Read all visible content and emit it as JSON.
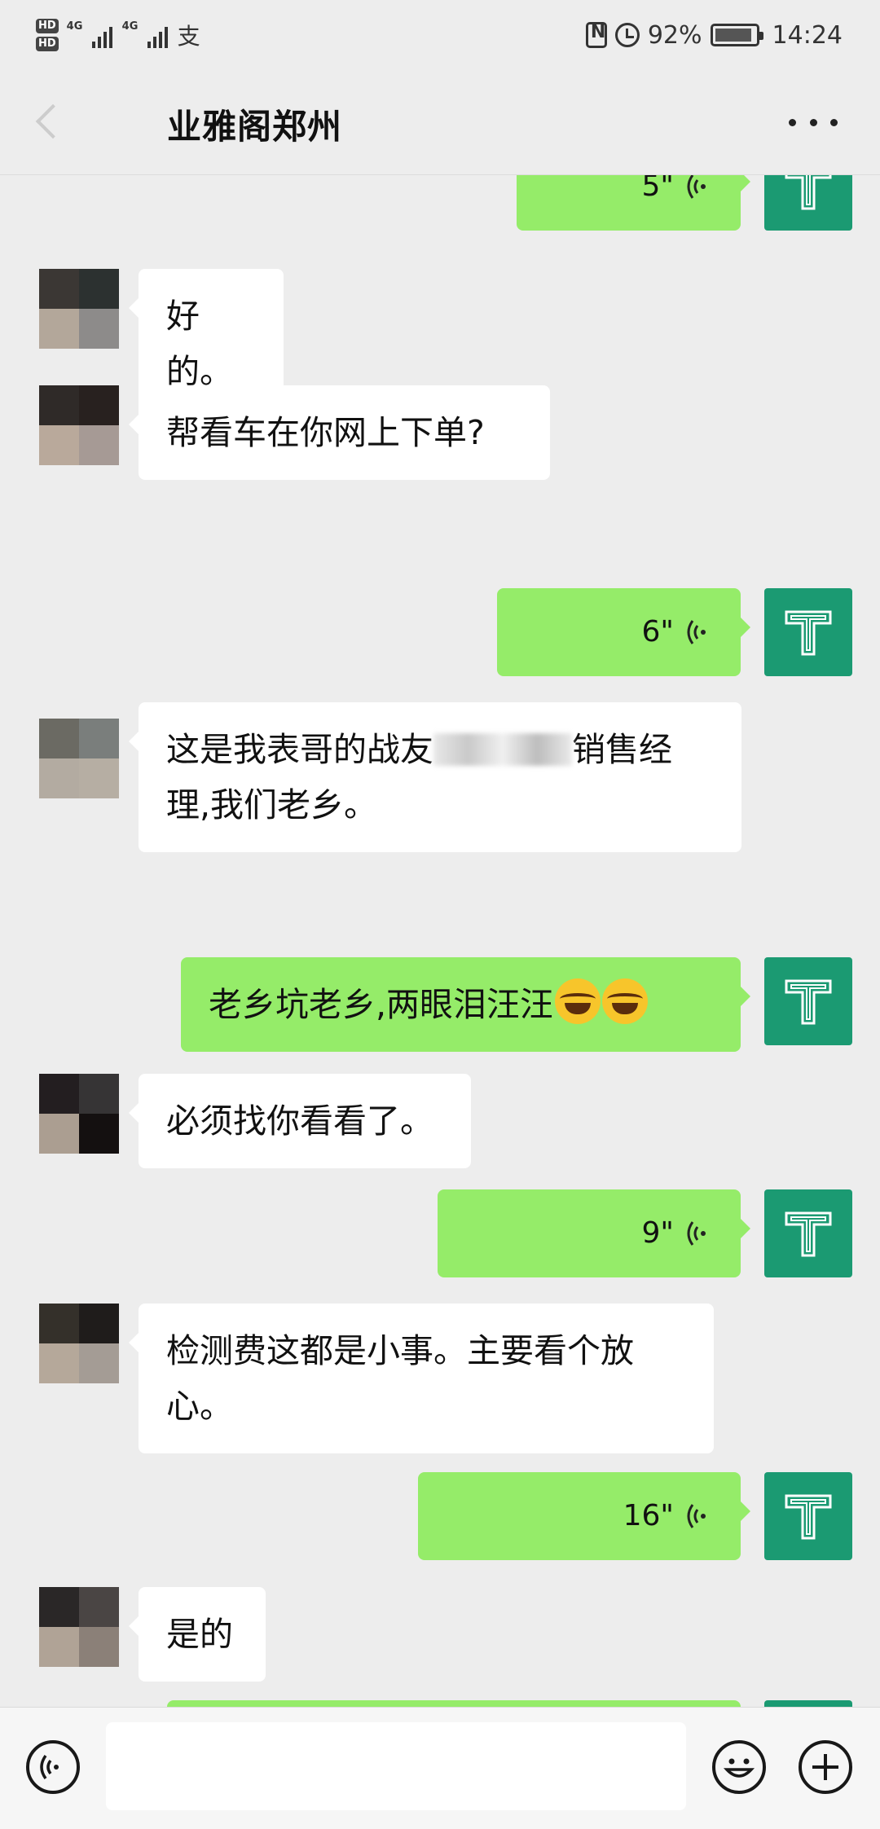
{
  "status_bar": {
    "hd_labels": [
      "HD",
      "HD"
    ],
    "network_labels": [
      "4G",
      "4G"
    ],
    "battery_percent": "92%",
    "time": "14:24",
    "icons": [
      "hd-icon",
      "signal-icon",
      "alipay-icon",
      "nfc-icon",
      "alarm-icon",
      "battery-icon"
    ]
  },
  "header": {
    "title": "业雅阁郑州",
    "icons": [
      "back-icon",
      "more-icon"
    ]
  },
  "messages": [
    {
      "side": "out",
      "type": "voice",
      "duration": "5\""
    },
    {
      "side": "in",
      "type": "text",
      "text": "好的。"
    },
    {
      "side": "in",
      "type": "text",
      "text": "帮看车在你网上下单?"
    },
    {
      "side": "out",
      "type": "voice",
      "duration": "6\""
    },
    {
      "side": "in",
      "type": "text",
      "text_part1": "这是我表哥的战友",
      "text_part2": "销售经理,我们老乡。"
    },
    {
      "side": "out",
      "type": "text",
      "text": "老乡坑老乡,两眼泪汪汪",
      "emoji": "crying-face-icon"
    },
    {
      "side": "in",
      "type": "text",
      "text": "必须找你看看了。"
    },
    {
      "side": "out",
      "type": "voice",
      "duration": "9\""
    },
    {
      "side": "in",
      "type": "text",
      "text": "检测费这都是小事。主要看个放心。"
    },
    {
      "side": "out",
      "type": "voice",
      "duration": "16\""
    },
    {
      "side": "in",
      "type": "text",
      "text": "是的"
    }
  ],
  "self_avatar": {
    "letter": "T",
    "color": "#1b9a72"
  },
  "bubble_colors": {
    "out": "#95ec69",
    "in": "#ffffff",
    "background": "#ededed"
  },
  "bottom_bar": {
    "icons": [
      "voice-input-icon",
      "emoji-icon",
      "plus-icon"
    ]
  }
}
